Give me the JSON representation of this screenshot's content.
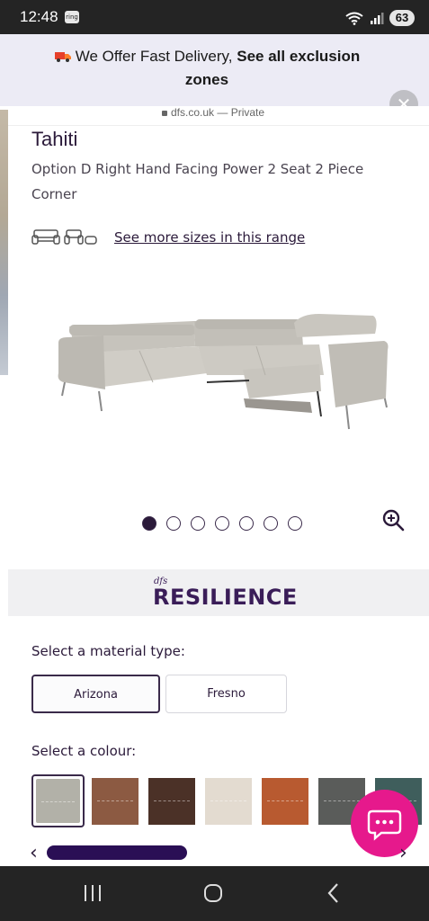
{
  "status_bar": {
    "time": "12:48",
    "notification_badge": "ring",
    "battery": "63",
    "icons": [
      "ring-icon",
      "wifi-icon",
      "signal-icon",
      "battery-icon"
    ]
  },
  "banner": {
    "text_plain": "We Offer Fast Delivery,",
    "text_bold": "See all exclusion zones",
    "icons": [
      "truck-icon",
      "close-icon"
    ]
  },
  "browser": {
    "url": "dfs.co.uk",
    "url_suffix": "— Private"
  },
  "product": {
    "title": "Tahiti",
    "description": "Option D Right Hand Facing Power 2 Seat 2 Piece Corner",
    "see_more_sizes": "See more sizes in this range",
    "gallery": {
      "total_images": 7,
      "active_index": 0
    }
  },
  "brand": {
    "small": "dfs",
    "name": "RESILIENCE"
  },
  "material": {
    "label": "Select a material type:",
    "options": [
      "Arizona",
      "Fresno"
    ],
    "selected": "Arizona"
  },
  "colour": {
    "label": "Select a colour:",
    "swatches": [
      "#b2b1a8",
      "#8c5a42",
      "#4b3127",
      "#e3dbd0",
      "#b85a30",
      "#5a5c5a",
      "#3f5e5c"
    ],
    "selected_index": 0
  },
  "colors": {
    "brand_purple": "#3a1d58",
    "chat_pink": "#e6198c",
    "banner_bg": "#ecebf5"
  }
}
